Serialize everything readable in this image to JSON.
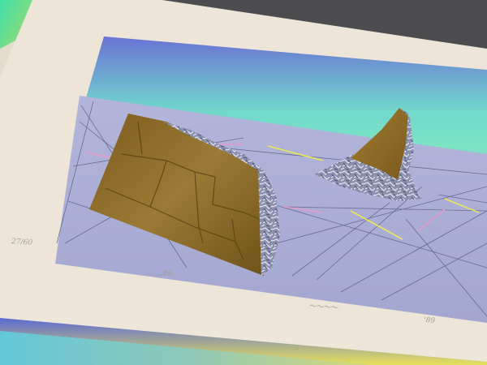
{
  "artwork": {
    "edition_number": "27/60",
    "pencil_title": "……  86",
    "signature": "～～～～",
    "year": "'89"
  },
  "colors": {
    "table_surface": "#4a4a4c",
    "paper": "#ece5d8",
    "sky_top": "#6b73d6",
    "sky_horizon": "#73e7c6",
    "ground": "#a7aad2",
    "ground_lines": "#5b5e86",
    "accent_yellow": "#e8e85a",
    "accent_pink": "#e09ac8",
    "block_face": "#8b6a26",
    "rock": "#8c92ae"
  }
}
